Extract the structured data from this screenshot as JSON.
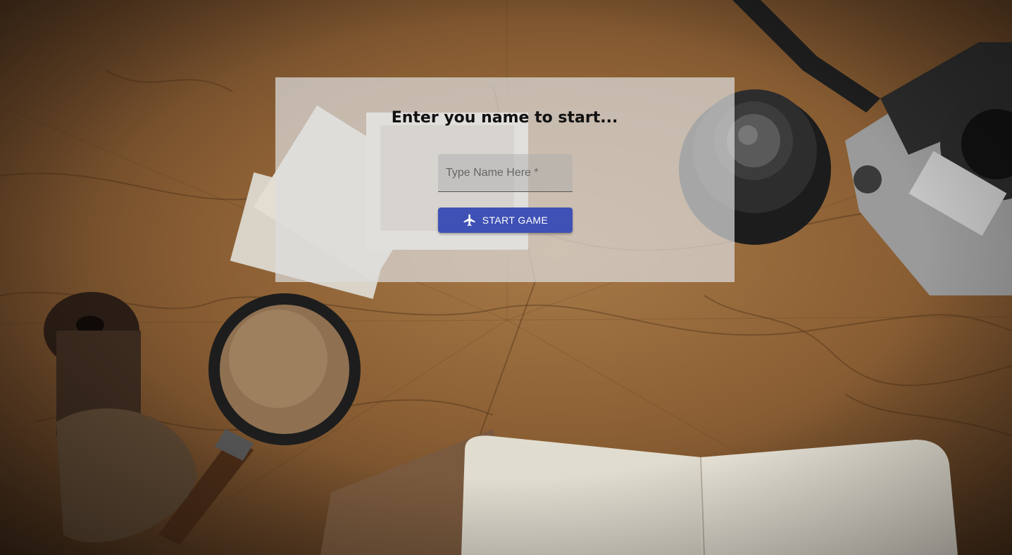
{
  "prompt": {
    "title": "Enter you name to start..."
  },
  "name_input": {
    "placeholder": "Type Name Here *",
    "value": ""
  },
  "start_button": {
    "label": "START GAME",
    "icon": "airplane-icon"
  },
  "colors": {
    "button": "#3f51b5",
    "panel": "rgba(220,220,220,0.72)"
  }
}
